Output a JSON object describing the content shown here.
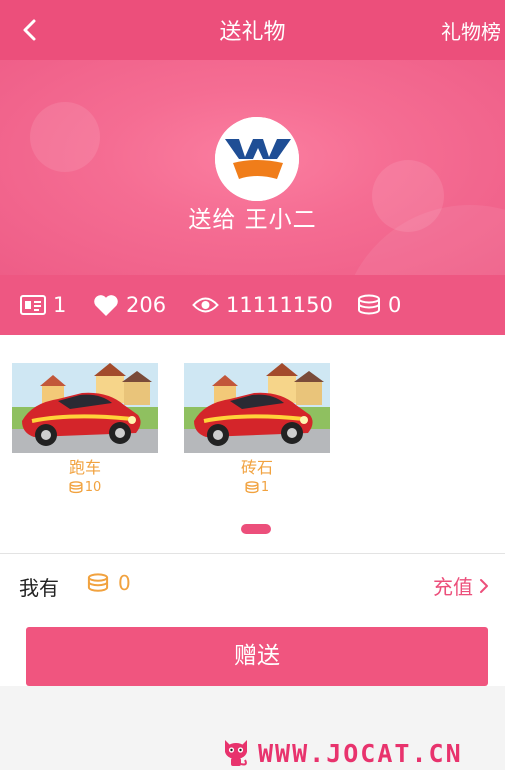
{
  "header": {
    "title": "送礼物",
    "rank_link": "礼物榜"
  },
  "hero": {
    "recipient_text": "送给 王小二"
  },
  "stats": [
    {
      "icon": "id-card-icon",
      "value": "1"
    },
    {
      "icon": "heart-icon",
      "value": "206"
    },
    {
      "icon": "eye-icon",
      "value": "11111150"
    },
    {
      "icon": "coin-stack-icon",
      "value": "0"
    }
  ],
  "gifts": [
    {
      "name": "跑车",
      "price": "10"
    },
    {
      "name": "砖石",
      "price": "1"
    }
  ],
  "balance": {
    "label": "我有",
    "value": "0",
    "recharge": "充值"
  },
  "send_button": "赠送",
  "watermark": "WWW.JOCAT.CN",
  "colors": {
    "primary": "#ec4f7b",
    "gold": "#f1a23f"
  }
}
